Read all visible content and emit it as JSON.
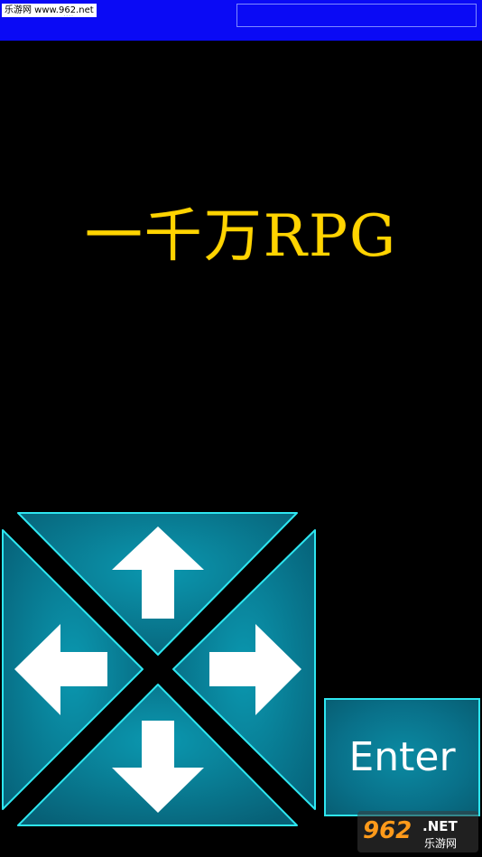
{
  "top_bar": {
    "watermark": "乐游网 www.962.net",
    "faint_text": "....",
    "color": "#0a0af5"
  },
  "game": {
    "title": "一千万RPG",
    "title_color": "#ffd400"
  },
  "controls": {
    "up_icon": "arrow-up-icon",
    "down_icon": "arrow-down-icon",
    "left_icon": "arrow-left-icon",
    "right_icon": "arrow-right-icon",
    "enter_label": "Enter",
    "button_color": "#0a8299",
    "border_color": "#2ee6f0"
  },
  "logo": {
    "number": "962",
    "suffix": ".NET",
    "name": "乐游网"
  }
}
